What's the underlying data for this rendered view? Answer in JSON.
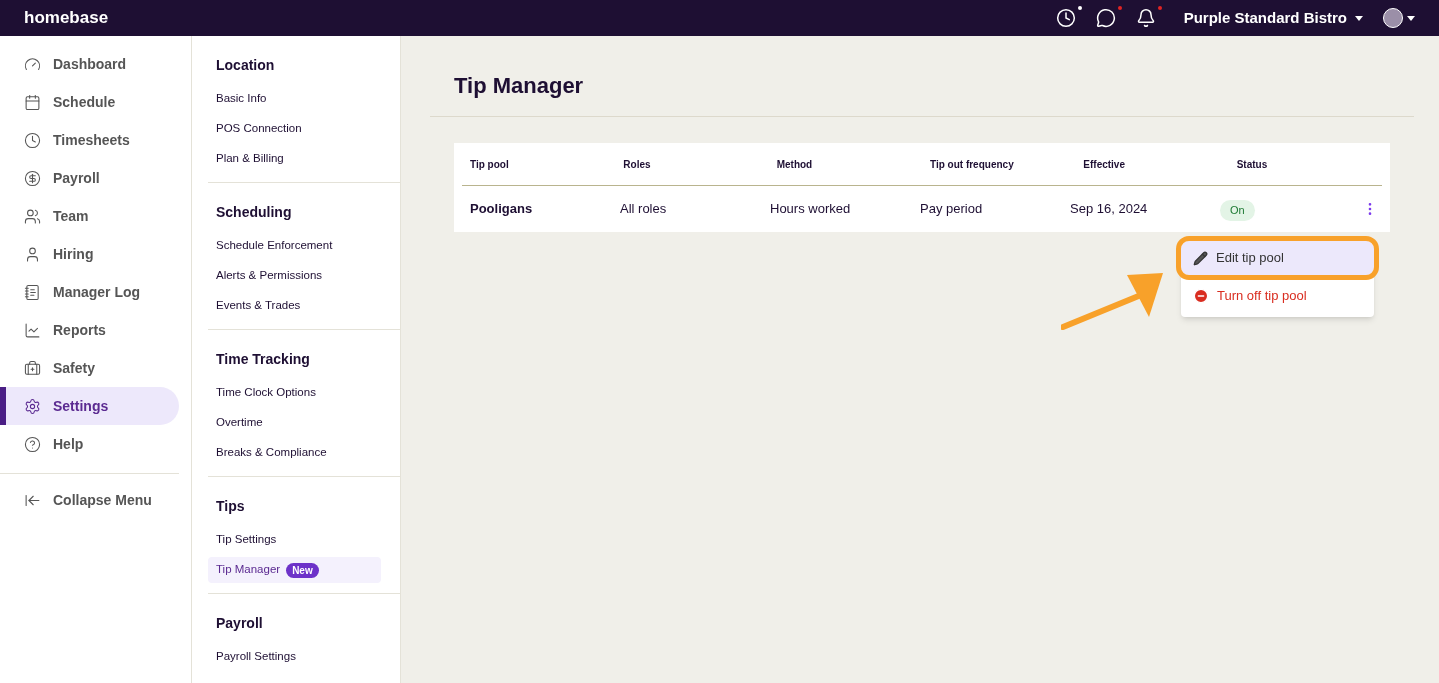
{
  "header": {
    "logo": "homebase",
    "icons": [
      {
        "color": "#ffffff"
      },
      {
        "color": "#e02424"
      },
      {
        "color": "#e02424"
      }
    ],
    "location": "Purple Standard Bistro"
  },
  "nav": {
    "items": [
      {
        "label": "Dashboard",
        "selected": false
      },
      {
        "label": "Schedule",
        "selected": false
      },
      {
        "label": "Timesheets",
        "selected": false
      },
      {
        "label": "Payroll",
        "selected": false
      },
      {
        "label": "Team",
        "selected": false
      },
      {
        "label": "Hiring",
        "selected": false
      },
      {
        "label": "Manager Log",
        "selected": false
      },
      {
        "label": "Reports",
        "selected": false
      },
      {
        "label": "Safety",
        "selected": false
      },
      {
        "label": "Settings",
        "selected": true
      },
      {
        "label": "Help",
        "selected": false
      }
    ],
    "collapse": "Collapse Menu"
  },
  "settings_nav": [
    {
      "title": "Location",
      "items": [
        {
          "label": "Basic Info",
          "selected": false
        },
        {
          "label": "POS Connection",
          "selected": false
        },
        {
          "label": "Plan & Billing",
          "selected": false
        }
      ]
    },
    {
      "title": "Scheduling",
      "items": [
        {
          "label": "Schedule Enforcement",
          "selected": false
        },
        {
          "label": "Alerts & Permissions",
          "selected": false
        },
        {
          "label": "Events & Trades",
          "selected": false
        }
      ]
    },
    {
      "title": "Time Tracking",
      "items": [
        {
          "label": "Time Clock Options",
          "selected": false
        },
        {
          "label": "Overtime",
          "selected": false
        },
        {
          "label": "Breaks & Compliance",
          "selected": false
        }
      ]
    },
    {
      "title": "Tips",
      "items": [
        {
          "label": "Tip Settings",
          "selected": false
        },
        {
          "label": "Tip Manager",
          "badge": "New",
          "selected": true
        }
      ]
    },
    {
      "title": "Payroll",
      "items": [
        {
          "label": "Payroll Settings",
          "selected": false
        }
      ]
    }
  ],
  "page": {
    "title": "Tip Manager"
  },
  "table": {
    "columns": [
      "Tip pool",
      "Roles",
      "Method",
      "Tip out frequency",
      "Effective",
      "Status"
    ],
    "rows": [
      {
        "cells": [
          "Pooligans",
          "All roles",
          "Hours worked",
          "Pay period",
          "Sep 16, 2024"
        ],
        "status": "On"
      }
    ]
  },
  "menu": {
    "items": [
      {
        "kind": "edit",
        "label": "Edit tip pool",
        "highlighted": true
      },
      {
        "kind": "danger",
        "label": "Turn off tip pool",
        "highlighted": false
      }
    ]
  }
}
